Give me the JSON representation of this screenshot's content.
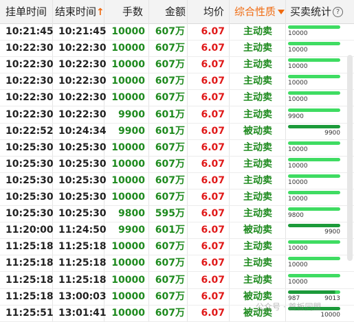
{
  "columns": {
    "order_time": "挂单时间",
    "end_time": "结束时间",
    "end_time_sort": "↑",
    "volume": "手数",
    "amount": "金额",
    "avg_price": "均价",
    "nature": "综合性质",
    "stats": "买卖统计",
    "help": "?"
  },
  "colors": {
    "active_bar": "#3fdc62",
    "passive_bar": "#1c9a3a",
    "sell_text": "#1e8a1e",
    "price_text": "#e01818",
    "accent": "#f06a0f"
  },
  "rows": [
    {
      "order_time": "10:21:45",
      "end_time": "10:21:45",
      "volume": "10000",
      "amount": "607万",
      "price": "6.07",
      "nature": "主动卖",
      "bar_left": "10000",
      "bar_right": "",
      "fill": 1.0,
      "kind": "active"
    },
    {
      "order_time": "10:22:30",
      "end_time": "10:22:30",
      "volume": "10000",
      "amount": "607万",
      "price": "6.07",
      "nature": "主动卖",
      "bar_left": "10000",
      "bar_right": "",
      "fill": 1.0,
      "kind": "active"
    },
    {
      "order_time": "10:22:30",
      "end_time": "10:22:30",
      "volume": "10000",
      "amount": "607万",
      "price": "6.07",
      "nature": "主动卖",
      "bar_left": "10000",
      "bar_right": "",
      "fill": 1.0,
      "kind": "active"
    },
    {
      "order_time": "10:22:30",
      "end_time": "10:22:30",
      "volume": "10000",
      "amount": "607万",
      "price": "6.07",
      "nature": "主动卖",
      "bar_left": "10000",
      "bar_right": "",
      "fill": 1.0,
      "kind": "active"
    },
    {
      "order_time": "10:22:30",
      "end_time": "10:22:30",
      "volume": "10000",
      "amount": "607万",
      "price": "6.07",
      "nature": "主动卖",
      "bar_left": "10000",
      "bar_right": "",
      "fill": 1.0,
      "kind": "active"
    },
    {
      "order_time": "10:22:30",
      "end_time": "10:22:30",
      "volume": "9900",
      "amount": "601万",
      "price": "6.07",
      "nature": "主动卖",
      "bar_left": "9900",
      "bar_right": "",
      "fill": 1.0,
      "kind": "active"
    },
    {
      "order_time": "10:22:52",
      "end_time": "10:24:34",
      "volume": "9900",
      "amount": "601万",
      "price": "6.07",
      "nature": "被动卖",
      "bar_left": "",
      "bar_right": "9900",
      "fill": 1.0,
      "kind": "passive"
    },
    {
      "order_time": "10:25:30",
      "end_time": "10:25:30",
      "volume": "10000",
      "amount": "607万",
      "price": "6.07",
      "nature": "主动卖",
      "bar_left": "10000",
      "bar_right": "",
      "fill": 1.0,
      "kind": "active"
    },
    {
      "order_time": "10:25:30",
      "end_time": "10:25:30",
      "volume": "10000",
      "amount": "607万",
      "price": "6.07",
      "nature": "主动卖",
      "bar_left": "10000",
      "bar_right": "",
      "fill": 1.0,
      "kind": "active"
    },
    {
      "order_time": "10:25:30",
      "end_time": "10:25:30",
      "volume": "10000",
      "amount": "607万",
      "price": "6.07",
      "nature": "主动卖",
      "bar_left": "10000",
      "bar_right": "",
      "fill": 1.0,
      "kind": "active"
    },
    {
      "order_time": "10:25:30",
      "end_time": "10:25:30",
      "volume": "10000",
      "amount": "607万",
      "price": "6.07",
      "nature": "主动卖",
      "bar_left": "10000",
      "bar_right": "",
      "fill": 1.0,
      "kind": "active"
    },
    {
      "order_time": "10:25:30",
      "end_time": "10:25:30",
      "volume": "9800",
      "amount": "595万",
      "price": "6.07",
      "nature": "主动卖",
      "bar_left": "9800",
      "bar_right": "",
      "fill": 1.0,
      "kind": "active"
    },
    {
      "order_time": "11:20:00",
      "end_time": "11:24:50",
      "volume": "9900",
      "amount": "601万",
      "price": "6.07",
      "nature": "被动卖",
      "bar_left": "",
      "bar_right": "9900",
      "fill": 1.0,
      "kind": "passive"
    },
    {
      "order_time": "11:25:18",
      "end_time": "11:25:18",
      "volume": "10000",
      "amount": "607万",
      "price": "6.07",
      "nature": "主动卖",
      "bar_left": "10000",
      "bar_right": "",
      "fill": 1.0,
      "kind": "active"
    },
    {
      "order_time": "11:25:18",
      "end_time": "11:25:18",
      "volume": "10000",
      "amount": "607万",
      "price": "6.07",
      "nature": "主动卖",
      "bar_left": "10000",
      "bar_right": "",
      "fill": 1.0,
      "kind": "active"
    },
    {
      "order_time": "11:25:18",
      "end_time": "11:25:18",
      "volume": "10000",
      "amount": "607万",
      "price": "6.07",
      "nature": "主动卖",
      "bar_left": "10000",
      "bar_right": "",
      "fill": 1.0,
      "kind": "active"
    },
    {
      "order_time": "11:25:18",
      "end_time": "13:00:03",
      "volume": "10000",
      "amount": "607万",
      "price": "6.07",
      "nature": "被动卖",
      "bar_left": "987",
      "bar_right": "9013",
      "fill": 0.9013,
      "kind": "passive"
    },
    {
      "order_time": "11:25:51",
      "end_time": "13:01:41",
      "volume": "10000",
      "amount": "607万",
      "price": "6.07",
      "nature": "被动卖",
      "bar_left": "",
      "bar_right": "10000",
      "fill": 1.0,
      "kind": "passive"
    }
  ],
  "watermark": "公众号 · 首板同盟"
}
